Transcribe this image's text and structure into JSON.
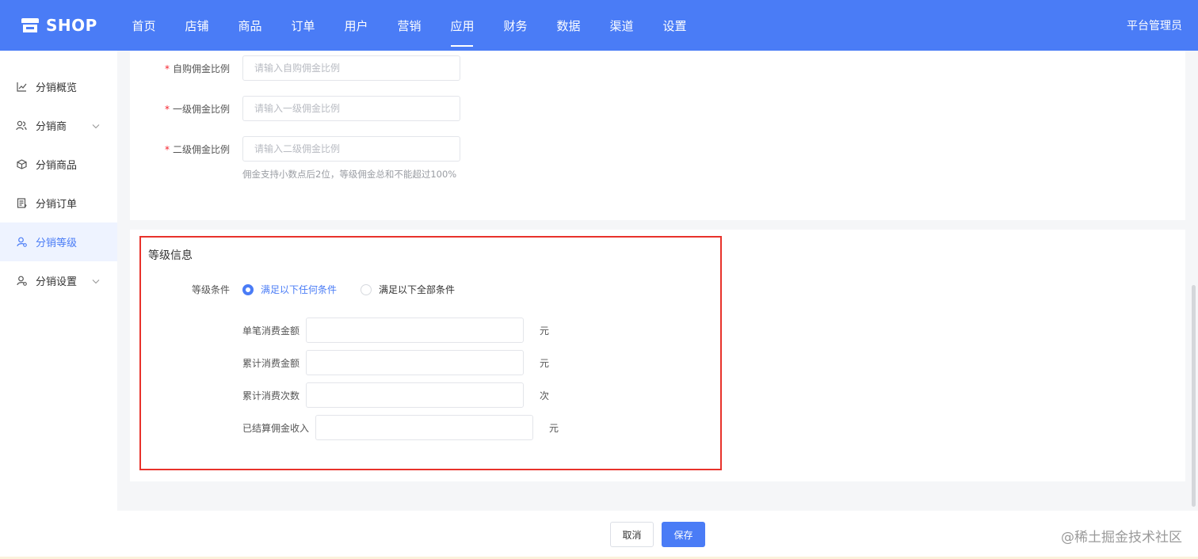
{
  "app": {
    "logo_text": "SHOP",
    "admin_label": "平台管理员"
  },
  "nav": {
    "items": [
      "首页",
      "店铺",
      "商品",
      "订单",
      "用户",
      "营销",
      "应用",
      "财务",
      "数据",
      "渠道",
      "设置"
    ],
    "active": "应用"
  },
  "sidebar": {
    "items": [
      {
        "label": "分销概览",
        "icon": "chart-line-icon",
        "has_arrow": false
      },
      {
        "label": "分销商",
        "icon": "users-icon",
        "has_arrow": true
      },
      {
        "label": "分销商品",
        "icon": "box-icon",
        "has_arrow": false
      },
      {
        "label": "分销订单",
        "icon": "document-icon",
        "has_arrow": false
      },
      {
        "label": "分销等级",
        "icon": "user-level-icon",
        "has_arrow": false,
        "active": true
      },
      {
        "label": "分销设置",
        "icon": "user-settings-icon",
        "has_arrow": true
      }
    ]
  },
  "commission": {
    "self_label": "自购佣金比例",
    "self_placeholder": "请输入自购佣金比例",
    "level1_label": "一级佣金比例",
    "level1_placeholder": "请输入一级佣金比例",
    "level2_label": "二级佣金比例",
    "level2_placeholder": "请输入二级佣金比例",
    "hint": "佣金支持小数点后2位，等级佣金总和不能超过100%"
  },
  "level_info": {
    "title": "等级信息",
    "condition_label": "等级条件",
    "option_any": "满足以下任何条件",
    "option_all": "满足以下全部条件",
    "selected": "any",
    "fields": [
      {
        "label": "单笔消费金额",
        "unit": "元",
        "value": ""
      },
      {
        "label": "累计消费金额",
        "unit": "元",
        "value": ""
      },
      {
        "label": "累计消费次数",
        "unit": "次",
        "value": ""
      },
      {
        "label": "已结算佣金收入",
        "unit": "元",
        "value": ""
      }
    ]
  },
  "footer": {
    "cancel_label": "取消",
    "save_label": "保存",
    "watermark": "@稀土掘金技术社区"
  },
  "colors": {
    "primary": "#4a7cf6",
    "highlight_border": "#e8322b",
    "required": "#f5222d"
  }
}
